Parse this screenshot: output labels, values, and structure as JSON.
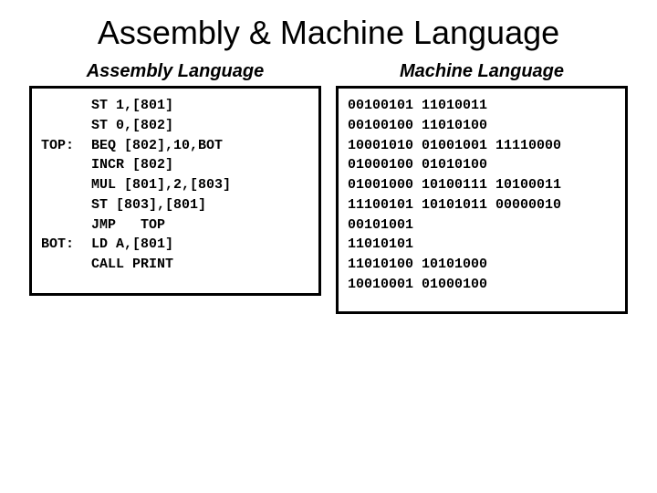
{
  "title": "Assembly & Machine Language",
  "left": {
    "heading": "Assembly Language",
    "lines": [
      {
        "label": "",
        "instr": "ST 1,[801]"
      },
      {
        "label": "",
        "instr": "ST 0,[802]"
      },
      {
        "label": "TOP:",
        "instr": "BEQ [802],10,BOT"
      },
      {
        "label": "",
        "instr": "INCR [802]"
      },
      {
        "label": "",
        "instr": "MUL [801],2,[803]"
      },
      {
        "label": "",
        "instr": "ST [803],[801]"
      },
      {
        "label": "",
        "instr": "JMP   TOP"
      },
      {
        "label": "BOT:",
        "instr": "LD A,[801]"
      },
      {
        "label": "",
        "instr": "CALL PRINT"
      }
    ]
  },
  "right": {
    "heading": "Machine Language",
    "lines": [
      "00100101 11010011",
      "00100100 11010100",
      "10001010 01001001 11110000",
      "01000100 01010100",
      "01001000 10100111 10100011",
      "11100101 10101011 00000010",
      "00101001",
      "11010101",
      "11010100 10101000",
      "10010001 01000100"
    ]
  }
}
